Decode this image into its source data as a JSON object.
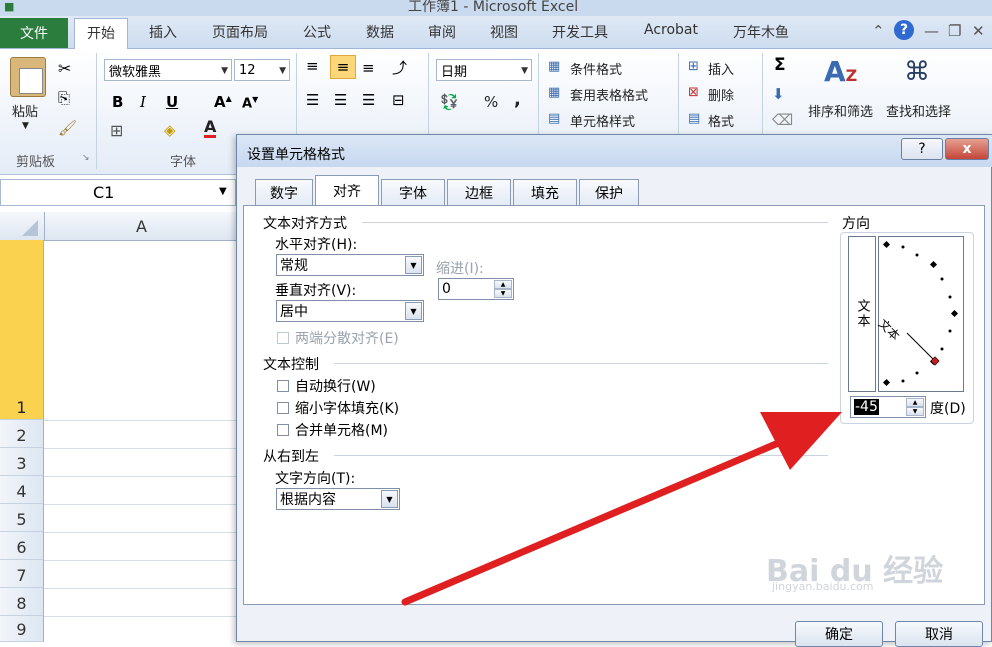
{
  "window": {
    "title": "工作簿1 - Microsoft Excel"
  },
  "ribbon_tabs": [
    "开始",
    "插入",
    "页面布局",
    "公式",
    "数据",
    "审阅",
    "视图",
    "开发工具",
    "Acrobat",
    "万年木鱼"
  ],
  "file_tab": "文件",
  "active_tab": "开始",
  "clipboard": {
    "paste_label": "粘贴",
    "group_label": "剪贴板"
  },
  "font": {
    "name": "微软雅黑",
    "size": "12",
    "group_label": "字体",
    "bold": "B",
    "italic": "I",
    "underline": "U"
  },
  "number": {
    "format": "日期",
    "percent": "%",
    "comma": ","
  },
  "styles": {
    "conditional": "条件格式",
    "table_format": "套用表格格式",
    "cell_style": "单元格样式"
  },
  "cells": {
    "insert": "插入",
    "delete": "删除",
    "format": "格式"
  },
  "editing": {
    "sigma": "Σ",
    "sort_filter": "排序和筛选",
    "find_select": "查找和选择"
  },
  "namebox": {
    "value": "C1"
  },
  "grid": {
    "column": "A",
    "rows": [
      "1",
      "2",
      "3",
      "4",
      "5",
      "6",
      "7",
      "8",
      "9"
    ]
  },
  "dialog": {
    "title": "设置单元格格式",
    "help": "?",
    "close": "x",
    "tabs": [
      "数字",
      "对齐",
      "字体",
      "边框",
      "填充",
      "保护"
    ],
    "active_tab": "对齐",
    "text_alignment": {
      "section": "文本对齐方式",
      "horizontal_label": "水平对齐(H):",
      "horizontal_value": "常规",
      "indent_label": "缩进(I):",
      "indent_value": "0",
      "vertical_label": "垂直对齐(V):",
      "vertical_value": "居中",
      "justify_distributed": "两端分散对齐(E)"
    },
    "text_control": {
      "section": "文本控制",
      "wrap": "自动换行(W)",
      "shrink": "缩小字体填充(K)",
      "merge": "合并单元格(M)"
    },
    "rtl": {
      "section": "从右到左",
      "direction_label": "文字方向(T):",
      "direction_value": "根据内容"
    },
    "orientation": {
      "section": "方向",
      "vertical_text": "文本",
      "dial_text": "文本",
      "degrees_value": "-45",
      "degrees_label": "度(D)"
    },
    "ok": "确定",
    "cancel": "取消"
  },
  "annotation_color": "#e02020",
  "watermark": {
    "brand": "Bai du 经验",
    "url": "jingyan.baidu.com"
  }
}
